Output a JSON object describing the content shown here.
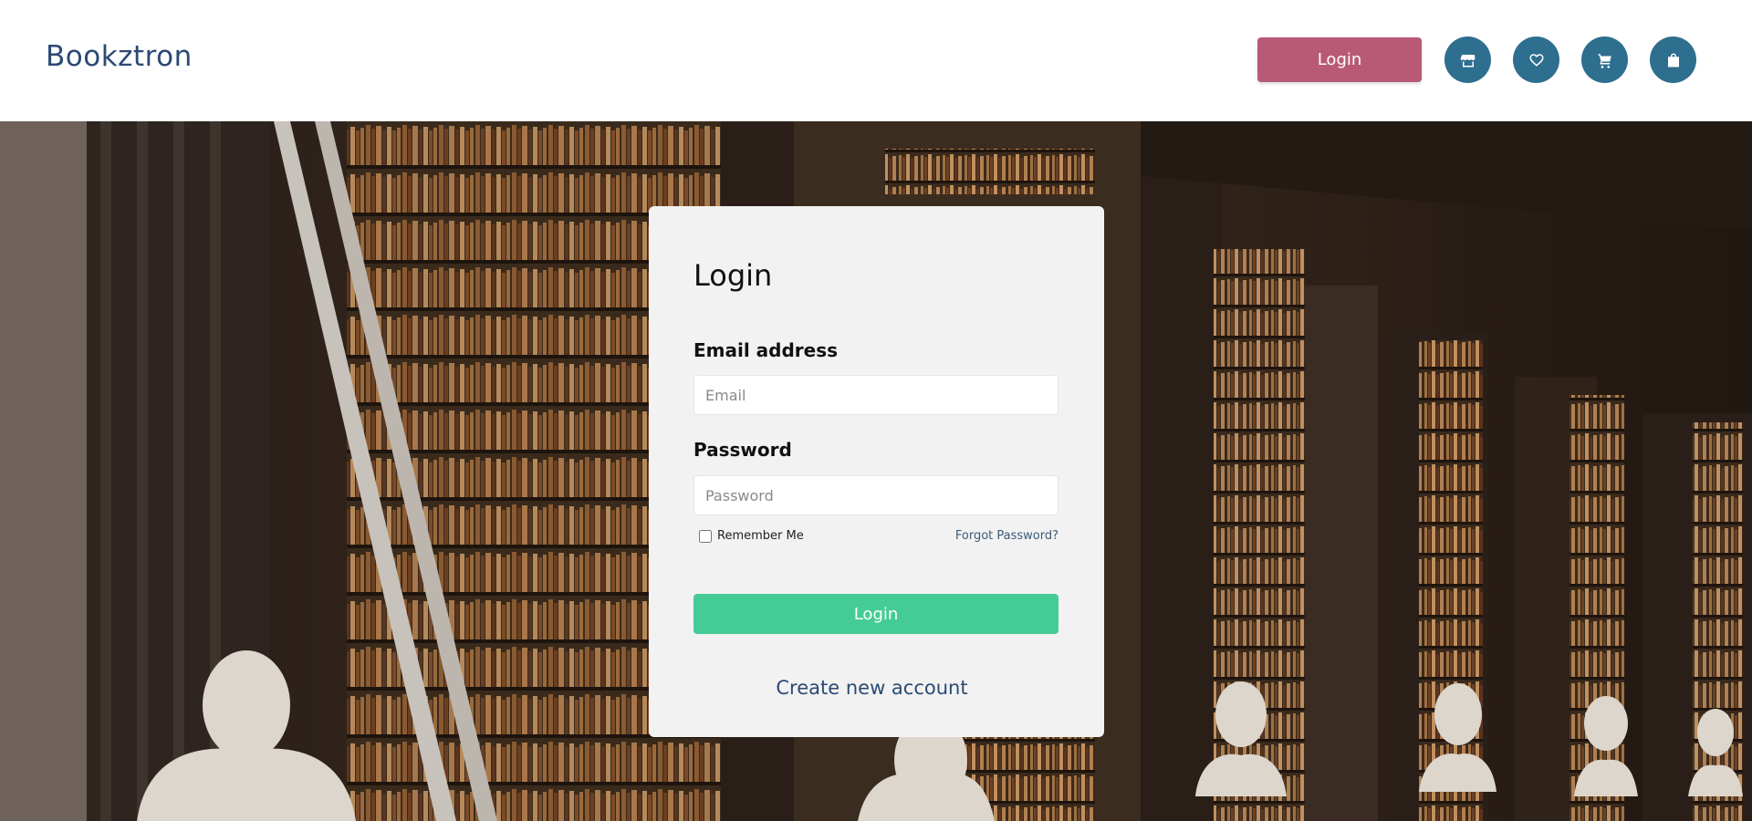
{
  "header": {
    "brand": "Bookztron",
    "login_label": "Login",
    "icons": [
      "store-icon",
      "heart-icon",
      "cart-icon",
      "bag-icon"
    ]
  },
  "login_card": {
    "title": "Login",
    "email": {
      "label": "Email address",
      "placeholder": "Email",
      "value": ""
    },
    "password": {
      "label": "Password",
      "placeholder": "Password",
      "value": ""
    },
    "remember_label": "Remember Me",
    "forgot_label": "Forgot Password?",
    "submit_label": "Login",
    "create_account_label": "Create new account"
  },
  "colors": {
    "brand": "#2c4a73",
    "header_login_bg": "#b85a75",
    "icon_button_bg": "#2e6e8e",
    "submit_bg": "#45cc96",
    "card_bg": "#f2f2f2"
  }
}
